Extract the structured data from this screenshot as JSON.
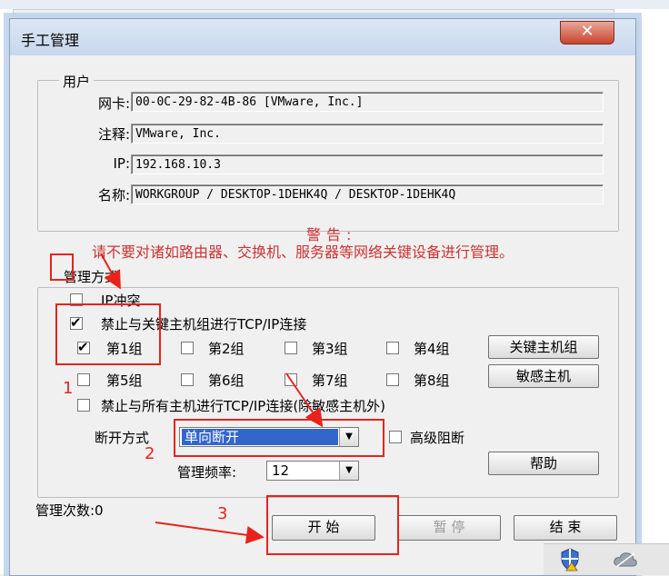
{
  "dialog": {
    "title": "手工管理",
    "close_glyph": "✕"
  },
  "user_group": {
    "legend": "用户",
    "fields": [
      {
        "label": "网卡:",
        "value": "00-0C-29-82-4B-86 [VMware, Inc.]"
      },
      {
        "label": "注释:",
        "value": "VMware, Inc."
      },
      {
        "label": "IP:",
        "value": "192.168.10.3"
      },
      {
        "label": "名称:",
        "value": "WORKGROUP / DESKTOP-1DEHK4Q / DESKTOP-1DEHK4Q"
      }
    ]
  },
  "warning": {
    "title": "警告:",
    "text": "请不要对诸如路由器、交换机、服务器等网络关键设备进行管理。"
  },
  "manage_group": {
    "legend": "管理方式",
    "ip_conflict": {
      "label": "IP冲突",
      "checked": false
    },
    "block_key": {
      "label": "禁止与关键主机组进行TCP/IP连接",
      "checked": true
    },
    "groups": [
      {
        "label": "第1组",
        "checked": true
      },
      {
        "label": "第2组",
        "checked": false
      },
      {
        "label": "第3组",
        "checked": false
      },
      {
        "label": "第4组",
        "checked": false
      },
      {
        "label": "第5组",
        "checked": false
      },
      {
        "label": "第6组",
        "checked": false
      },
      {
        "label": "第7组",
        "checked": false
      },
      {
        "label": "第8组",
        "checked": false
      }
    ],
    "block_all": {
      "label": "禁止与所有主机进行TCP/IP连接(除敏感主机外)",
      "checked": false
    },
    "key_hosts_button": "关键主机组",
    "sensitive_hosts_button": "敏感主机",
    "disconnect_label": "断开方式",
    "disconnect_value": "单向断开",
    "advanced_block": {
      "label": "高级阻断",
      "checked": false
    },
    "frequency_label": "管理频率:",
    "frequency_value": "12",
    "help_button": "帮助"
  },
  "footer": {
    "count_label": "管理次数:0",
    "start_button": "开 始",
    "pause_button": "暂 停",
    "end_button": "结 束"
  },
  "annotations": [
    "1",
    "2",
    "3"
  ],
  "colors": {
    "warning_text": "#cc3333",
    "annotation": "#e8231c",
    "selected_combo": "#3366cc"
  }
}
